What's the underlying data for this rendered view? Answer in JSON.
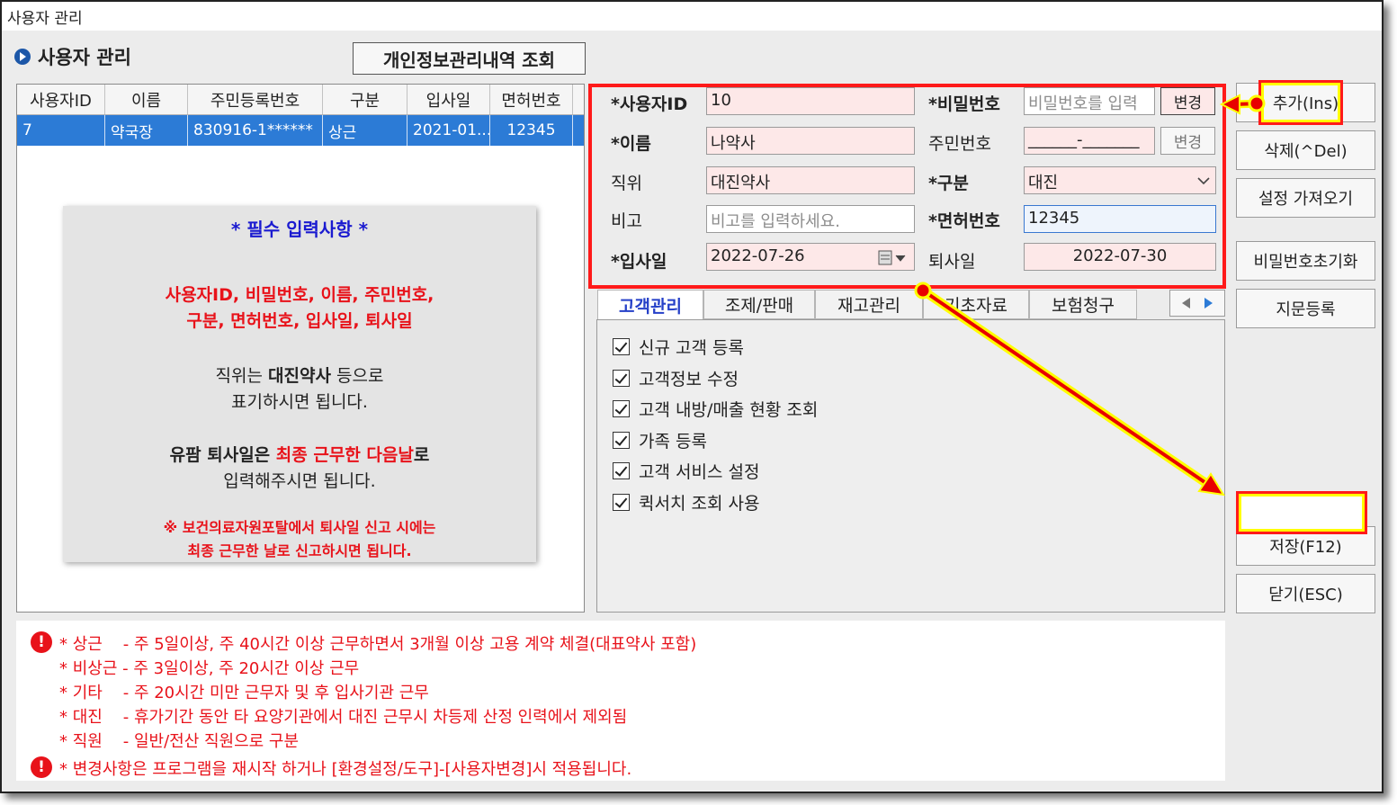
{
  "window": {
    "title": "사용자 관리"
  },
  "header": {
    "title": "사용자 관리",
    "privacy_button": "개인정보관리내역 조회"
  },
  "grid": {
    "columns": [
      "사용자ID",
      "이름",
      "주민등록번호",
      "구분",
      "입사일",
      "면허번호"
    ],
    "rows": [
      [
        "7",
        "약국장",
        "830916-1******",
        "상근",
        "2021-01...",
        "12345"
      ]
    ]
  },
  "notes": {
    "title": "* 필수 입력사항 *",
    "required_line1": "사용자ID, 비밀번호, 이름, 주민번호,",
    "required_line2": "구분, 면허번호, 입사일, 퇴사일",
    "pos_a": "직위는 ",
    "pos_b": "대진약사",
    "pos_c": " 등으로",
    "pos_line2": "표기하시면 됩니다.",
    "ret_a": "유팜 퇴사일은 ",
    "ret_b": "최종 근무한 다음날",
    "ret_c": "로",
    "ret_line2": "입력해주시면 됩니다.",
    "portal_line1": "※ 보건의료자원포탈에서 퇴사일 신고 시에는",
    "portal_line2": "최종 근무한 날로 신고하시면 됩니다."
  },
  "form": {
    "user_id_label": "*사용자ID",
    "user_id_value": "10",
    "password_label": "*비밀번호",
    "password_placeholder": "비밀번호를 입력",
    "change_label": "변경",
    "name_label": "*이름",
    "name_value": "나약사",
    "rrn_label": "주민번호",
    "rrn_value": "______-_______",
    "position_label": "직위",
    "position_value": "대진약사",
    "type_label": "*구분",
    "type_value": "대진",
    "memo_label": "비고",
    "memo_placeholder": "비고를 입력하세요.",
    "license_label": "*면허번호",
    "license_value": "12345",
    "hire_label": "*입사일",
    "hire_value": "2022-07-26",
    "retire_label": "퇴사일",
    "retire_value": "2022-07-30"
  },
  "tabs": [
    "고객관리",
    "조제/판매",
    "재고관리",
    "기초자료",
    "보험청구"
  ],
  "permissions": [
    "신규 고객 등록",
    "고객정보 수정",
    "고객 내방/매출 현황 조회",
    "가족 등록",
    "고객 서비스 설정",
    "퀵서치 조회 사용"
  ],
  "buttons": {
    "add": "추가(Ins)",
    "delete": "삭제(^Del)",
    "import": "설정 가져오기",
    "reset_pw": "비밀번호초기화",
    "fingerprint": "지문등록",
    "save": "저장(F12)",
    "close": "닫기(ESC)"
  },
  "bottom_notes": {
    "l1": "* 상근    - 주 5일이상, 주 40시간 이상 근무하면서 3개월 이상 고용 계약 체결(대표약사 포함)",
    "l2": "* 비상근 - 주 3일이상, 주 20시간 이상 근무",
    "l3": "* 기타    - 주 20시간 미만 근무자 및 후 입사기관 근무",
    "l4": "* 대진    - 휴가기간 동안 타 요양기관에서 대진 근무시 차등제 산정 인력에서 제외됨",
    "l5": "* 직원    - 일반/전산 직원으로 구분",
    "l6": "* 변경사항은 프로그램을 재시작 하거나 [환경설정/도구]-[사용자변경]시 적용됩니다.",
    "warn_glyph": "!"
  },
  "colors": {
    "highlight": "#ff1a1a",
    "arrow": "#e80000",
    "glow": "#ffff00",
    "selected_row": "#2c7bd6"
  }
}
